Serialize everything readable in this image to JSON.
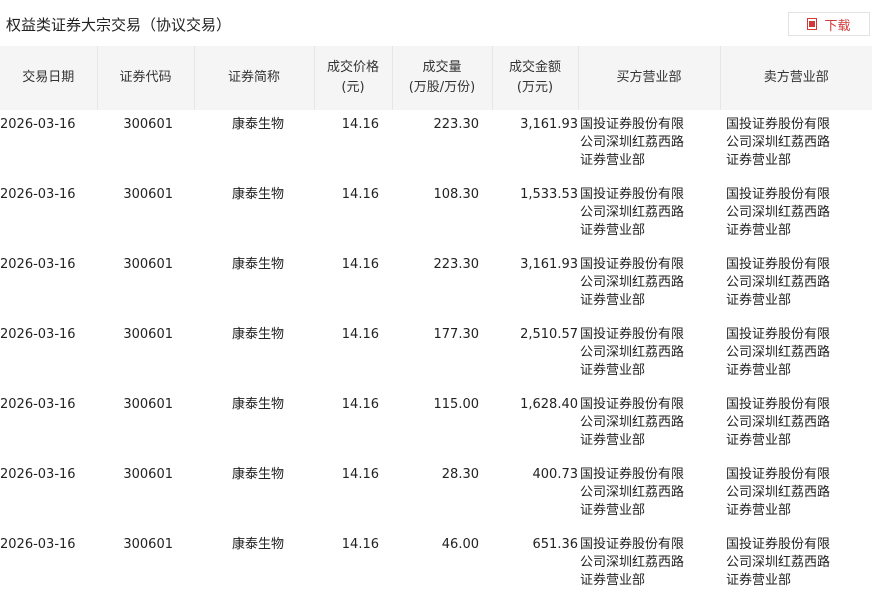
{
  "page": {
    "title": "权益类证券大宗交易（协议交易）",
    "download_label": "下载"
  },
  "table": {
    "headers": [
      {
        "line1": "交易日期",
        "line2": ""
      },
      {
        "line1": "证券代码",
        "line2": ""
      },
      {
        "line1": "证券简称",
        "line2": ""
      },
      {
        "line1": "成交价格",
        "line2": "(元)"
      },
      {
        "line1": "成交量",
        "line2": "(万股/万份)"
      },
      {
        "line1": "成交金额",
        "line2": "(万元)"
      },
      {
        "line1": "买方营业部",
        "line2": ""
      },
      {
        "line1": "卖方营业部",
        "line2": ""
      }
    ],
    "rows": [
      {
        "date": "2026-03-16",
        "code": "300601",
        "name": "康泰生物",
        "price": "14.16",
        "volume": "223.30",
        "amount": "3,161.93",
        "buyer": "国投证券股份有限公司深圳红荔西路证券营业部",
        "seller": "国投证券股份有限公司深圳红荔西路证券营业部"
      },
      {
        "date": "2026-03-16",
        "code": "300601",
        "name": "康泰生物",
        "price": "14.16",
        "volume": "108.30",
        "amount": "1,533.53",
        "buyer": "国投证券股份有限公司深圳红荔西路证券营业部",
        "seller": "国投证券股份有限公司深圳红荔西路证券营业部"
      },
      {
        "date": "2026-03-16",
        "code": "300601",
        "name": "康泰生物",
        "price": "14.16",
        "volume": "223.30",
        "amount": "3,161.93",
        "buyer": "国投证券股份有限公司深圳红荔西路证券营业部",
        "seller": "国投证券股份有限公司深圳红荔西路证券营业部"
      },
      {
        "date": "2026-03-16",
        "code": "300601",
        "name": "康泰生物",
        "price": "14.16",
        "volume": "177.30",
        "amount": "2,510.57",
        "buyer": "国投证券股份有限公司深圳红荔西路证券营业部",
        "seller": "国投证券股份有限公司深圳红荔西路证券营业部"
      },
      {
        "date": "2026-03-16",
        "code": "300601",
        "name": "康泰生物",
        "price": "14.16",
        "volume": "115.00",
        "amount": "1,628.40",
        "buyer": "国投证券股份有限公司深圳红荔西路证券营业部",
        "seller": "国投证券股份有限公司深圳红荔西路证券营业部"
      },
      {
        "date": "2026-03-16",
        "code": "300601",
        "name": "康泰生物",
        "price": "14.16",
        "volume": "28.30",
        "amount": "400.73",
        "buyer": "国投证券股份有限公司深圳红荔西路证券营业部",
        "seller": "国投证券股份有限公司深圳红荔西路证券营业部"
      },
      {
        "date": "2026-03-16",
        "code": "300601",
        "name": "康泰生物",
        "price": "14.16",
        "volume": "46.00",
        "amount": "651.36",
        "buyer": "国投证券股份有限公司深圳红荔西路证券营业部",
        "seller": "国投证券股份有限公司深圳红荔西路证券营业部"
      }
    ]
  },
  "colors": {
    "accent": "#d23a3a",
    "header_bg": "#f5f5f5",
    "border": "#e6e6e6"
  },
  "icons": {
    "download": "document-icon"
  }
}
